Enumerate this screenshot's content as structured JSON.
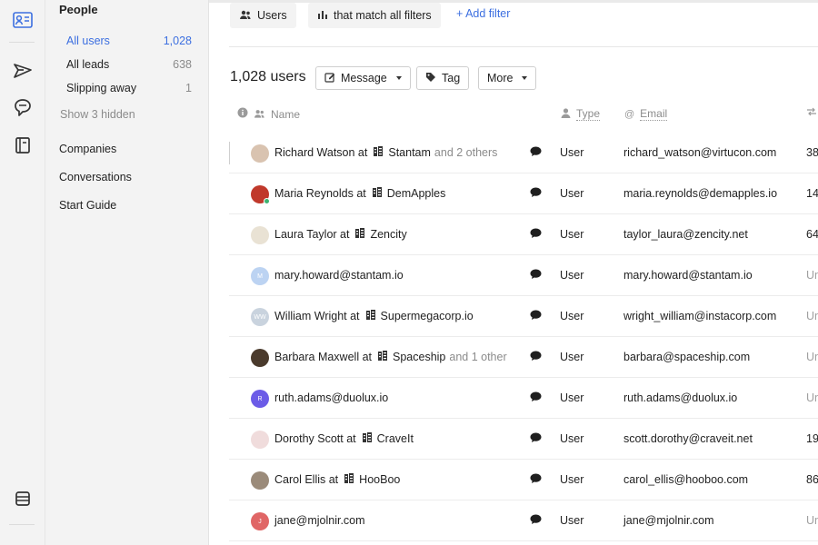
{
  "rail": {
    "icons": [
      "contacts-icon",
      "send-icon",
      "chat-bubble-icon",
      "book-icon",
      "database-icon"
    ]
  },
  "sidebar": {
    "title": "People",
    "items": [
      {
        "label": "All users",
        "count": "1,028"
      },
      {
        "label": "All leads",
        "count": "638"
      },
      {
        "label": "Slipping away",
        "count": "1"
      }
    ],
    "hidden_label": "Show 3 hidden",
    "sections": [
      "Companies",
      "Conversations",
      "Start Guide"
    ]
  },
  "filters": {
    "chip1": "Users",
    "chip2": "that match all filters",
    "add_filter": "+ Add filter"
  },
  "toolbar": {
    "count": "1,028 users",
    "message": "Message",
    "tag": "Tag",
    "more": "More"
  },
  "table": {
    "headers": {
      "name": "Name",
      "type": "Type",
      "email": "Email"
    },
    "rows": [
      {
        "name": "Richard Watson at",
        "company": "Stantam",
        "others": "and 2 others",
        "type": "User",
        "email": "richard_watson@virtucon.com",
        "tail": "38",
        "avatar": "",
        "avatar_color": "#d9c3b0"
      },
      {
        "name": "Maria Reynolds at",
        "company": "DemApples",
        "others": "",
        "type": "User",
        "email": "maria.reynolds@demapples.io",
        "tail": "14",
        "avatar": "",
        "avatar_color": "#c0392b"
      },
      {
        "name": "Laura Taylor at",
        "company": "Zencity",
        "others": "",
        "type": "User",
        "email": "taylor_laura@zencity.net",
        "tail": "64",
        "avatar": "",
        "avatar_color": "#e9e2d4"
      },
      {
        "name": "mary.howard@stantam.io",
        "company": "",
        "others": "",
        "type": "User",
        "email": "mary.howard@stantam.io",
        "tail": "Un",
        "avatar": "M",
        "avatar_color": "#bcd3f2"
      },
      {
        "name": "William Wright at",
        "company": "Supermegacorp.io",
        "others": "",
        "type": "User",
        "email": "wright_william@instacorp.com",
        "tail": "Un",
        "avatar": "WW",
        "avatar_color": "#c9d3de"
      },
      {
        "name": "Barbara Maxwell at",
        "company": "Spaceship",
        "others": "and 1 other",
        "type": "User",
        "email": "barbara@spaceship.com",
        "tail": "Un",
        "avatar": "",
        "avatar_color": "#4a3a2c"
      },
      {
        "name": "ruth.adams@duolux.io",
        "company": "",
        "others": "",
        "type": "User",
        "email": "ruth.adams@duolux.io",
        "tail": "Un",
        "avatar": "R",
        "avatar_color": "#6c5ce7"
      },
      {
        "name": "Dorothy Scott at",
        "company": "CraveIt",
        "others": "",
        "type": "User",
        "email": "scott.dorothy@craveit.net",
        "tail": "19",
        "avatar": "",
        "avatar_color": "#f0dcdc"
      },
      {
        "name": "Carol Ellis at",
        "company": "HooBoo",
        "others": "",
        "type": "User",
        "email": "carol_ellis@hooboo.com",
        "tail": "86",
        "avatar": "",
        "avatar_color": "#9b8b7a"
      },
      {
        "name": "jane@mjolnir.com",
        "company": "",
        "others": "",
        "type": "User",
        "email": "jane@mjolnir.com",
        "tail": "Un",
        "avatar": "J",
        "avatar_color": "#e06666"
      }
    ]
  },
  "colors": {
    "accent": "#3c6fe0",
    "muted": "#8b8b8b"
  }
}
